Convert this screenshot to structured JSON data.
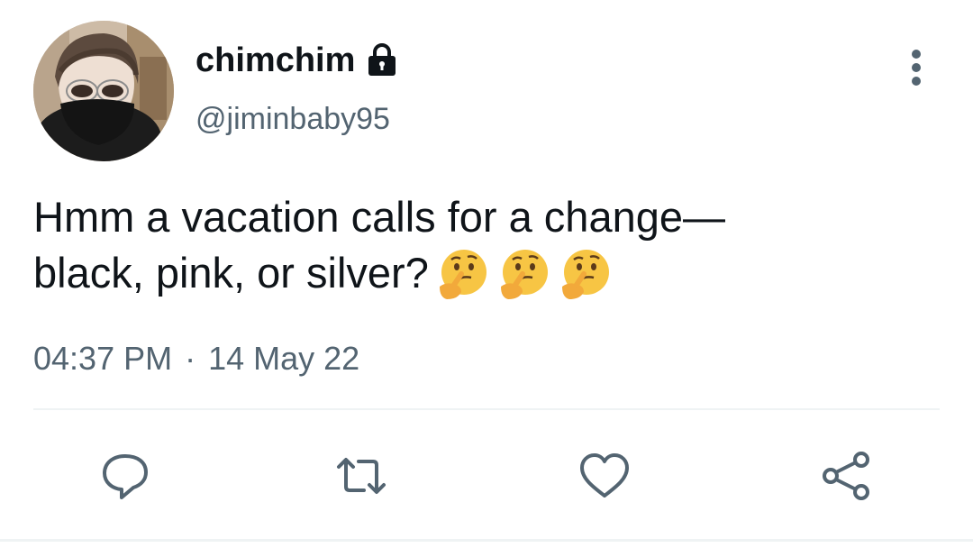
{
  "user": {
    "display_name": "chimchim",
    "handle": "@jiminbaby95",
    "protected": true
  },
  "tweet": {
    "text_line1": "Hmm a vacation calls for a change—",
    "text_line2": "black, pink, or silver?",
    "emojis": [
      "thinking-face",
      "thinking-face",
      "thinking-face"
    ],
    "time": "04:37 PM",
    "separator": "·",
    "date": "14 May 22"
  },
  "actions": {
    "icons": [
      "reply-icon",
      "retweet-icon",
      "like-icon",
      "share-icon"
    ]
  },
  "colors": {
    "text": "#0f1419",
    "secondary": "#536471",
    "icon": "#536471",
    "divider": "#eff3f4",
    "emoji": "#f7c544"
  }
}
